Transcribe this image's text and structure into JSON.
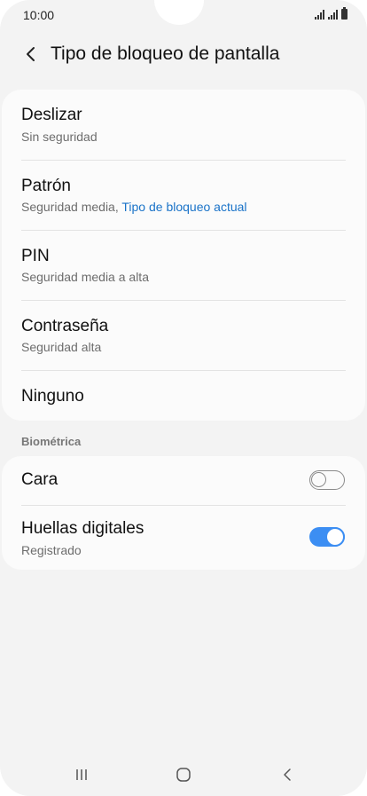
{
  "status_bar": {
    "time": "10:00"
  },
  "header": {
    "title": "Tipo de bloqueo de pantalla"
  },
  "lock_options": [
    {
      "title": "Deslizar",
      "subtitle": "Sin seguridad"
    },
    {
      "title": "Patrón",
      "subtitle": "Seguridad media, ",
      "subtitle_accent": "Tipo de bloqueo actual"
    },
    {
      "title": "PIN",
      "subtitle": "Seguridad media a alta"
    },
    {
      "title": "Contraseña",
      "subtitle": "Seguridad alta"
    },
    {
      "title": "Ninguno"
    }
  ],
  "biometrics": {
    "section_label": "Biométrica",
    "items": [
      {
        "title": "Cara",
        "enabled": false
      },
      {
        "title": "Huellas digitales",
        "subtitle": "Registrado",
        "enabled": true
      }
    ]
  },
  "colors": {
    "accent": "#1a73c8",
    "toggle_on": "#3c8ef3",
    "background": "#f3f3f3",
    "card": "#fbfbfb"
  },
  "icons": {
    "back": "chevron-left-icon",
    "nav_recent": "recent-apps-icon",
    "nav_home": "home-icon",
    "nav_back": "back-icon"
  }
}
